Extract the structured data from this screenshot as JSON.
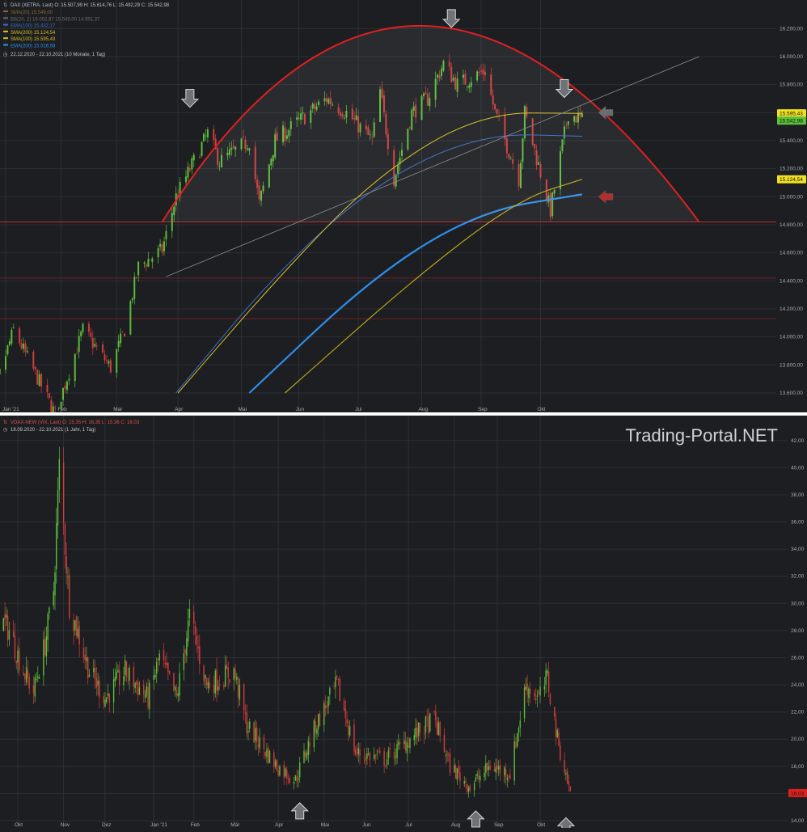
{
  "colors": {
    "background": "#1c1e22",
    "grid": "#2c2f35",
    "tick_text": "#a8abb0",
    "up_candle": "#5cbf3a",
    "down_candle": "#d43c3c",
    "ema100": "#3a6fc8",
    "ema200": "#2f8ee8",
    "sma100": "#d8c020",
    "sma200": "#b8a418",
    "arc": "#e02020",
    "support_line": "#c42828",
    "minor_support": "#8a2020",
    "trendline": "#8a8d92",
    "separator": "#ffffff",
    "watermark": "#cfd2d6"
  },
  "watermark": "Trading-Portal.NET",
  "top_legend": {
    "symbol_line": "DAX (XETRA, Last)  O: 15.507,99  H: 15.614,76  L: 15.492,29  C: 15.542,98",
    "items": [
      {
        "label": "SMA(20)  15.549,00",
        "color": "#8a6a2a"
      },
      {
        "label": "BB(20, 2)  16.052,97  15.549,00  14.951,37",
        "color": "#6a6a6a"
      },
      {
        "label": "EMA(100)  15.432,17",
        "color": "#3a6fc8"
      },
      {
        "label": "SMA(200)  15.124,54",
        "color": "#d8c020"
      },
      {
        "label": "SMA(100)  15.595,43",
        "color": "#d8c020"
      },
      {
        "label": "EMA(200)  15.016,58",
        "color": "#2f8ee8"
      }
    ],
    "period": "22.12.2020 - 22.10.2021  (10 Monate, 1 Tag)"
  },
  "bottom_legend": {
    "symbol_line": "VDAX-NEW (VIX, Last)  O: 15,35  H: 16,35  L: 15,36  C: 16,03",
    "period": "18.09.2020 - 22.10.2021  (1 Jahr, 1 Tag)"
  },
  "chart_data": [
    {
      "type": "candlestick",
      "title": "DAX (XETRA, Last)",
      "ylim": [
        13600,
        16300
      ],
      "y_ticks": [
        "13.600,00",
        "13.800,00",
        "14.000,00",
        "14.200,00",
        "14.400,00",
        "14.600,00",
        "14.800,00",
        "15.000,00",
        "15.200,00",
        "15.400,00",
        "15.600,00",
        "15.800,00",
        "16.000,00",
        "16.200,00"
      ],
      "x_ticks": [
        "Jan '21",
        "Feb",
        "Mar",
        "Apr",
        "Mai",
        "Jun",
        "Jul",
        "Aug",
        "Sep",
        "Okt"
      ],
      "price_path": [
        {
          "date": "2020-12-22",
          "value": 13290
        },
        {
          "date": "2021-01-08",
          "value": 14050
        },
        {
          "date": "2021-01-29",
          "value": 13450
        },
        {
          "date": "2021-02-12",
          "value": 14050
        },
        {
          "date": "2021-02-26",
          "value": 13780
        },
        {
          "date": "2021-03-05",
          "value": 14050
        },
        {
          "date": "2021-03-12",
          "value": 14500
        },
        {
          "date": "2021-03-24",
          "value": 14620
        },
        {
          "date": "2021-03-31",
          "value": 15000
        },
        {
          "date": "2021-04-16",
          "value": 15450
        },
        {
          "date": "2021-04-22",
          "value": 15250
        },
        {
          "date": "2021-05-07",
          "value": 15400
        },
        {
          "date": "2021-05-12",
          "value": 14950
        },
        {
          "date": "2021-05-20",
          "value": 15400
        },
        {
          "date": "2021-06-15",
          "value": 15700
        },
        {
          "date": "2021-06-25",
          "value": 15600
        },
        {
          "date": "2021-07-08",
          "value": 15400
        },
        {
          "date": "2021-07-12",
          "value": 15750
        },
        {
          "date": "2021-07-19",
          "value": 15130
        },
        {
          "date": "2021-07-28",
          "value": 15600
        },
        {
          "date": "2021-08-05",
          "value": 15700
        },
        {
          "date": "2021-08-13",
          "value": 15950
        },
        {
          "date": "2021-08-20",
          "value": 15800
        },
        {
          "date": "2021-09-03",
          "value": 15900
        },
        {
          "date": "2021-09-08",
          "value": 15600
        },
        {
          "date": "2021-09-20",
          "value": 15130
        },
        {
          "date": "2021-09-23",
          "value": 15600
        },
        {
          "date": "2021-10-06",
          "value": 14900
        },
        {
          "date": "2021-10-15",
          "value": 15600
        },
        {
          "date": "2021-10-22",
          "value": 15543
        }
      ],
      "series": [
        {
          "name": "EMA(100)",
          "values": [
            {
              "date": "2021-03-31",
              "value": 13600
            },
            {
              "date": "2021-05-20",
              "value": 14450
            },
            {
              "date": "2021-07-10",
              "value": 15100
            },
            {
              "date": "2021-09-01",
              "value": 15450
            },
            {
              "date": "2021-10-22",
              "value": 15432
            }
          ]
        },
        {
          "name": "SMA(100)",
          "values": [
            {
              "date": "2021-04-01",
              "value": 13600
            },
            {
              "date": "2021-05-20",
              "value": 14400
            },
            {
              "date": "2021-07-10",
              "value": 15150
            },
            {
              "date": "2021-09-01",
              "value": 15600
            },
            {
              "date": "2021-10-22",
              "value": 15595
            }
          ]
        },
        {
          "name": "EMA(200)",
          "values": [
            {
              "date": "2021-05-07",
              "value": 13600
            },
            {
              "date": "2021-07-10",
              "value": 14450
            },
            {
              "date": "2021-09-01",
              "value": 14900
            },
            {
              "date": "2021-10-22",
              "value": 15017
            }
          ]
        },
        {
          "name": "SMA(200)",
          "values": [
            {
              "date": "2021-05-25",
              "value": 13600
            },
            {
              "date": "2021-08-01",
              "value": 14450
            },
            {
              "date": "2021-09-20",
              "value": 14980
            },
            {
              "date": "2021-10-22",
              "value": 15125
            }
          ]
        }
      ],
      "price_labels": [
        {
          "value": 15595.43,
          "label": "15.595,43",
          "bg": "#f0e020"
        },
        {
          "value": 15542.98,
          "label": "15.542,98",
          "bg": "#5cbf3a"
        },
        {
          "value": 15124.54,
          "label": "15.124,54",
          "bg": "#f0e020"
        }
      ],
      "horizontal_lines": [
        {
          "value": 14820,
          "color": "#c42828"
        },
        {
          "value": 14420,
          "color": "#8a2020"
        },
        {
          "value": 14130,
          "color": "#8a2020"
        }
      ],
      "annotations": {
        "arc": {
          "from": {
            "date": "2021-03-24",
            "value": 14820
          },
          "peak": {
            "date": "2021-08-01",
            "value": 16220
          },
          "to": {
            "date": "2021-12-20",
            "value": 14820
          }
        },
        "trendline": {
          "from": {
            "date": "2021-03-26",
            "value": 14430
          },
          "to": {
            "date": "2021-12-20",
            "value": 16000
          }
        },
        "down_arrows": [
          {
            "date": "2021-04-07",
            "value": 15650
          },
          {
            "date": "2021-08-17",
            "value": 16220
          },
          {
            "date": "2021-10-13",
            "value": 15720
          }
        ],
        "left_arrows": [
          {
            "date": "2021-10-31",
            "value": 15600
          },
          {
            "date": "2021-10-31",
            "value": 15000
          }
        ]
      }
    },
    {
      "type": "candlestick",
      "title": "VDAX-NEW (VIX, Last)",
      "ylim": [
        14,
        43
      ],
      "y_ticks": [
        "14,00",
        "16,00",
        "18,00",
        "20,00",
        "22,00",
        "24,00",
        "26,00",
        "28,00",
        "30,00",
        "32,00",
        "34,00",
        "36,00",
        "38,00",
        "40,00",
        "42,00"
      ],
      "x_ticks": [
        "Okt",
        "Nov",
        "Dez",
        "Jan '21",
        "Feb",
        "Mär",
        "Apr",
        "Mai",
        "Jun",
        "Jul",
        "Aug",
        "Sep",
        "Okt"
      ],
      "price_path": [
        {
          "date": "2020-09-18",
          "value": 29
        },
        {
          "date": "2020-09-25",
          "value": 28
        },
        {
          "date": "2020-10-05",
          "value": 25
        },
        {
          "date": "2020-10-12",
          "value": 23.5
        },
        {
          "date": "2020-10-20",
          "value": 27
        },
        {
          "date": "2020-10-26",
          "value": 31
        },
        {
          "date": "2020-10-30",
          "value": 40
        },
        {
          "date": "2020-11-06",
          "value": 30
        },
        {
          "date": "2020-11-20",
          "value": 25
        },
        {
          "date": "2020-12-01",
          "value": 23
        },
        {
          "date": "2020-12-15",
          "value": 25
        },
        {
          "date": "2020-12-31",
          "value": 23
        },
        {
          "date": "2021-01-08",
          "value": 26
        },
        {
          "date": "2021-01-20",
          "value": 23
        },
        {
          "date": "2021-01-29",
          "value": 29
        },
        {
          "date": "2021-02-10",
          "value": 24
        },
        {
          "date": "2021-03-01",
          "value": 25
        },
        {
          "date": "2021-03-10",
          "value": 21
        },
        {
          "date": "2021-03-31",
          "value": 18
        },
        {
          "date": "2021-04-13",
          "value": 17
        },
        {
          "date": "2021-04-27",
          "value": 21
        },
        {
          "date": "2021-05-12",
          "value": 24
        },
        {
          "date": "2021-05-25",
          "value": 19
        },
        {
          "date": "2021-06-15",
          "value": 18.5
        },
        {
          "date": "2021-07-19",
          "value": 21.5
        },
        {
          "date": "2021-07-30",
          "value": 18
        },
        {
          "date": "2021-08-13",
          "value": 16.5
        },
        {
          "date": "2021-08-27",
          "value": 18
        },
        {
          "date": "2021-09-10",
          "value": 17.5
        },
        {
          "date": "2021-09-21",
          "value": 24
        },
        {
          "date": "2021-09-30",
          "value": 23
        },
        {
          "date": "2021-10-06",
          "value": 24.5
        },
        {
          "date": "2021-10-13",
          "value": 20
        },
        {
          "date": "2021-10-22",
          "value": 16.03
        }
      ],
      "price_labels": [
        {
          "value": 16.03,
          "label": "16,03",
          "bg": "#e02020"
        }
      ],
      "annotations": {
        "up_arrows": [
          {
            "date": "2021-04-16",
            "value": 15.2
          },
          {
            "date": "2021-08-17",
            "value": 14.6
          },
          {
            "date": "2021-10-19",
            "value": 14.1
          }
        ]
      }
    }
  ]
}
